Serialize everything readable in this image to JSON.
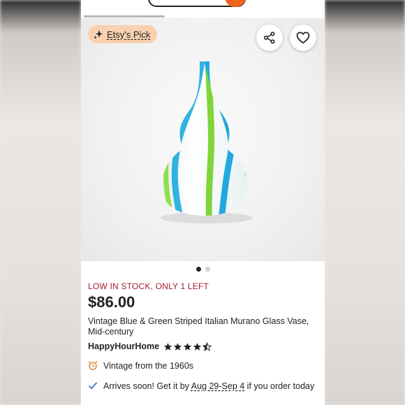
{
  "badge": {
    "label": "Etsy's Pick"
  },
  "gallery": {
    "image_count": 2,
    "active_index": 0
  },
  "listing": {
    "stock_notice": "LOW IN STOCK, ONLY 1 LEFT",
    "price": "$86.00",
    "title": "Vintage Blue & Green Striped Italian Murano Glass Vase, Mid-century",
    "seller": "HappyHourHome",
    "rating": 4.5,
    "vintage_text": "Vintage from the 1960s",
    "shipping": {
      "prefix": "Arrives soon! Get it by ",
      "dates": "Aug 29-Sep 4",
      "suffix": " if you order today"
    }
  },
  "colors": {
    "brand": "#f1641e",
    "stock_text": "#a61a2e",
    "badge_bg": "#f9d1b0",
    "check": "#2a6fb5"
  },
  "icons": [
    "sparkle-icon",
    "share-icon",
    "heart-icon",
    "star-icon",
    "alarm-clock-icon",
    "checkmark-icon"
  ]
}
